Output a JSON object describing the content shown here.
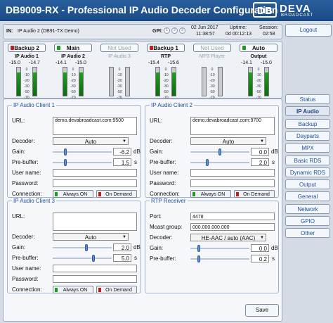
{
  "title": "DB9009-RX - Professional IP Audio Decoder Configuration",
  "logo": {
    "mark": "DB",
    "brand": "DEVA",
    "tagline": "BROADCAST"
  },
  "info": {
    "in_label": "IN:",
    "in_value": "IP Audio 2 (DB91-TX Demo)",
    "gpi_label": "GPI:",
    "gpi": [
      "1",
      "2",
      "3"
    ],
    "date": "02 Jun 2017",
    "time": "11:38:57",
    "uptime_label": "Uptime:",
    "uptime": "0d 00:12:13",
    "session_label": "Session:",
    "session": "02:58"
  },
  "logout": "Logout",
  "scale": [
    "0",
    "-10",
    "-20",
    "-30",
    "-50",
    "-70"
  ],
  "meters": [
    {
      "button": "Backup 2",
      "led": "#c21d1d",
      "label": "IP Audio 1",
      "l": "-15.0",
      "r": "-14.7",
      "level_l": 0.83,
      "level_r": 0.83,
      "dim": false
    },
    {
      "button": "Main",
      "led": "#1b9a1b",
      "label": "IP Audio 2",
      "l": "-14.1",
      "r": "-15.0",
      "level_l": 0.83,
      "level_r": 0.83,
      "dim": false
    },
    {
      "button": "Not Used",
      "led": "",
      "label": "IP Audio 3",
      "l": "",
      "r": "",
      "level_l": 0,
      "level_r": 0,
      "dim": true
    },
    {
      "button": "Backup 1",
      "led": "#c21d1d",
      "label": "RTP",
      "l": "-15.4",
      "r": "-15.6",
      "level_l": 0.83,
      "level_r": 0.83,
      "dim": false
    },
    {
      "button": "Not Used",
      "led": "",
      "label": "MP3 Player",
      "l": "",
      "r": "",
      "level_l": 0,
      "level_r": 0,
      "dim": true
    },
    {
      "button": "Auto",
      "led": "#1b9a1b",
      "label": "Output",
      "l": "-14.1",
      "r": "-15.0",
      "level_l": 0.83,
      "level_r": 0.83,
      "dim": false
    }
  ],
  "nav": [
    "Status",
    "IP Audio",
    "Backup",
    "Dayparts",
    "MPX",
    "Basic RDS",
    "Dynamic RDS",
    "Output",
    "General",
    "Network",
    "GPIO",
    "Other"
  ],
  "nav_active": "IP Audio",
  "labels": {
    "url": "URL:",
    "decoder": "Decoder:",
    "gain": "Gain:",
    "prebuffer": "Pre-buffer:",
    "username": "User name:",
    "password": "Password:",
    "connection": "Connection:",
    "always_on": "Always ON",
    "on_demand": "On Demand",
    "db": "dB",
    "s": "s",
    "port": "Port:",
    "mcast": "Mcast group:"
  },
  "client1": {
    "legend": "IP Audio Client 1",
    "url": "demo.devabroadcast.com:9500",
    "decoder": "Auto",
    "gain": "-6.2",
    "gain_pos": 0.2,
    "prebuffer": "1.5",
    "pre_pos": 0.2
  },
  "client2": {
    "legend": "IP Audio Client 2",
    "url": "demo.devabroadcast.com:9700",
    "decoder": "Auto",
    "gain": "0.0",
    "gain_pos": 0.5,
    "prebuffer": "2.0",
    "pre_pos": 0.27
  },
  "client3": {
    "legend": "IP Audio Client 3",
    "url": "",
    "decoder": "Auto",
    "gain": "2.0",
    "gain_pos": 0.58,
    "prebuffer": "5.0",
    "pre_pos": 0.7
  },
  "rtp": {
    "legend": "RTP Receiver",
    "port": "4478",
    "mcast": "000.000.000.000",
    "decoder": "HE-AAC / auto (AAC)",
    "gain": "0.0",
    "gain_pos": 0.12,
    "prebuffer": "0.2",
    "pre_pos": 0.12
  },
  "save": "Save",
  "colors": {
    "header": "#1f5594",
    "accent": "#1e4f9a",
    "led_green": "#1b9a1b",
    "led_red": "#c21d1d"
  }
}
